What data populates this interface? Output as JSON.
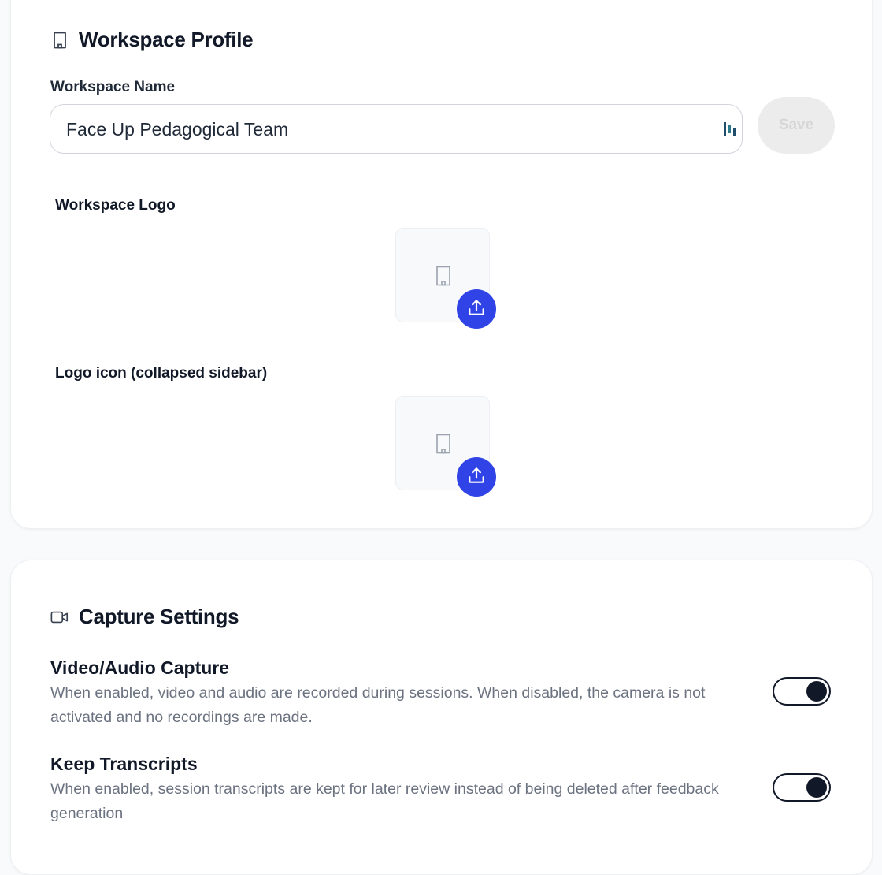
{
  "profile": {
    "title": "Workspace Profile",
    "title_icon": "building-icon",
    "name_label": "Workspace Name",
    "name_value": "Face Up Pedagogical Team",
    "save_label": "Save",
    "logo_label": "Workspace Logo",
    "logo_icon_label": "Logo icon (collapsed sidebar)"
  },
  "capture": {
    "title": "Capture Settings",
    "title_icon": "video-camera-icon",
    "settings": [
      {
        "title": "Video/Audio Capture",
        "description": "When enabled, video and audio are recorded during sessions. When disabled, the camera is not activated and no recordings are made.",
        "enabled": true
      },
      {
        "title": "Keep Transcripts",
        "description": "When enabled, session transcripts are kept for later review instead of being deleted after feedback generation",
        "enabled": true
      }
    ]
  },
  "colors": {
    "accent": "#2f43e6",
    "toggle_on": "#111827",
    "save_disabled_bg": "#ececec"
  }
}
